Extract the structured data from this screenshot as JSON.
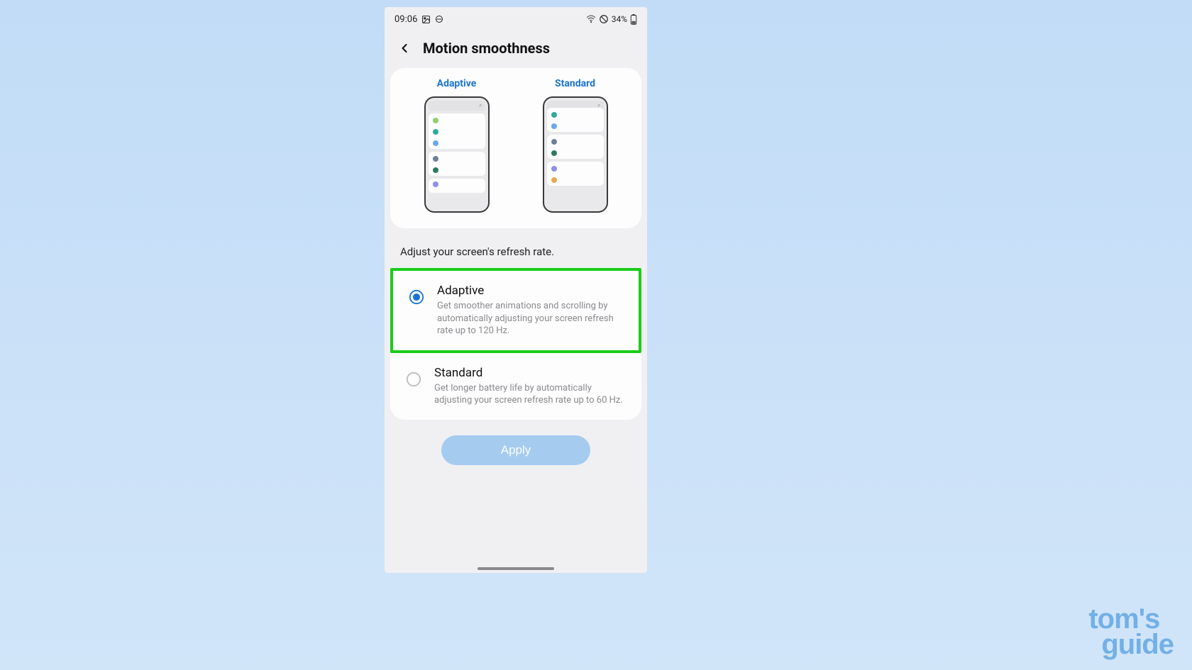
{
  "status": {
    "time": "09:06",
    "battery": "34%"
  },
  "page": {
    "title": "Motion smoothness",
    "description": "Adjust your screen's refresh rate."
  },
  "preview": {
    "adaptive_label": "Adaptive",
    "standard_label": "Standard"
  },
  "options": {
    "adaptive": {
      "title": "Adaptive",
      "desc": "Get smoother animations and scrolling by automatically adjusting your screen refresh rate up to 120 Hz.",
      "selected": true,
      "highlighted": true
    },
    "standard": {
      "title": "Standard",
      "desc": "Get longer battery life by automatically adjusting your screen refresh rate up to 60 Hz.",
      "selected": false,
      "highlighted": false
    }
  },
  "apply_label": "Apply",
  "watermark": {
    "line1": "tom's",
    "line2": "guide"
  },
  "colors": {
    "accent": "#1a73d1",
    "highlight": "#1bcc1b",
    "apply_bg": "#a5cbef"
  }
}
